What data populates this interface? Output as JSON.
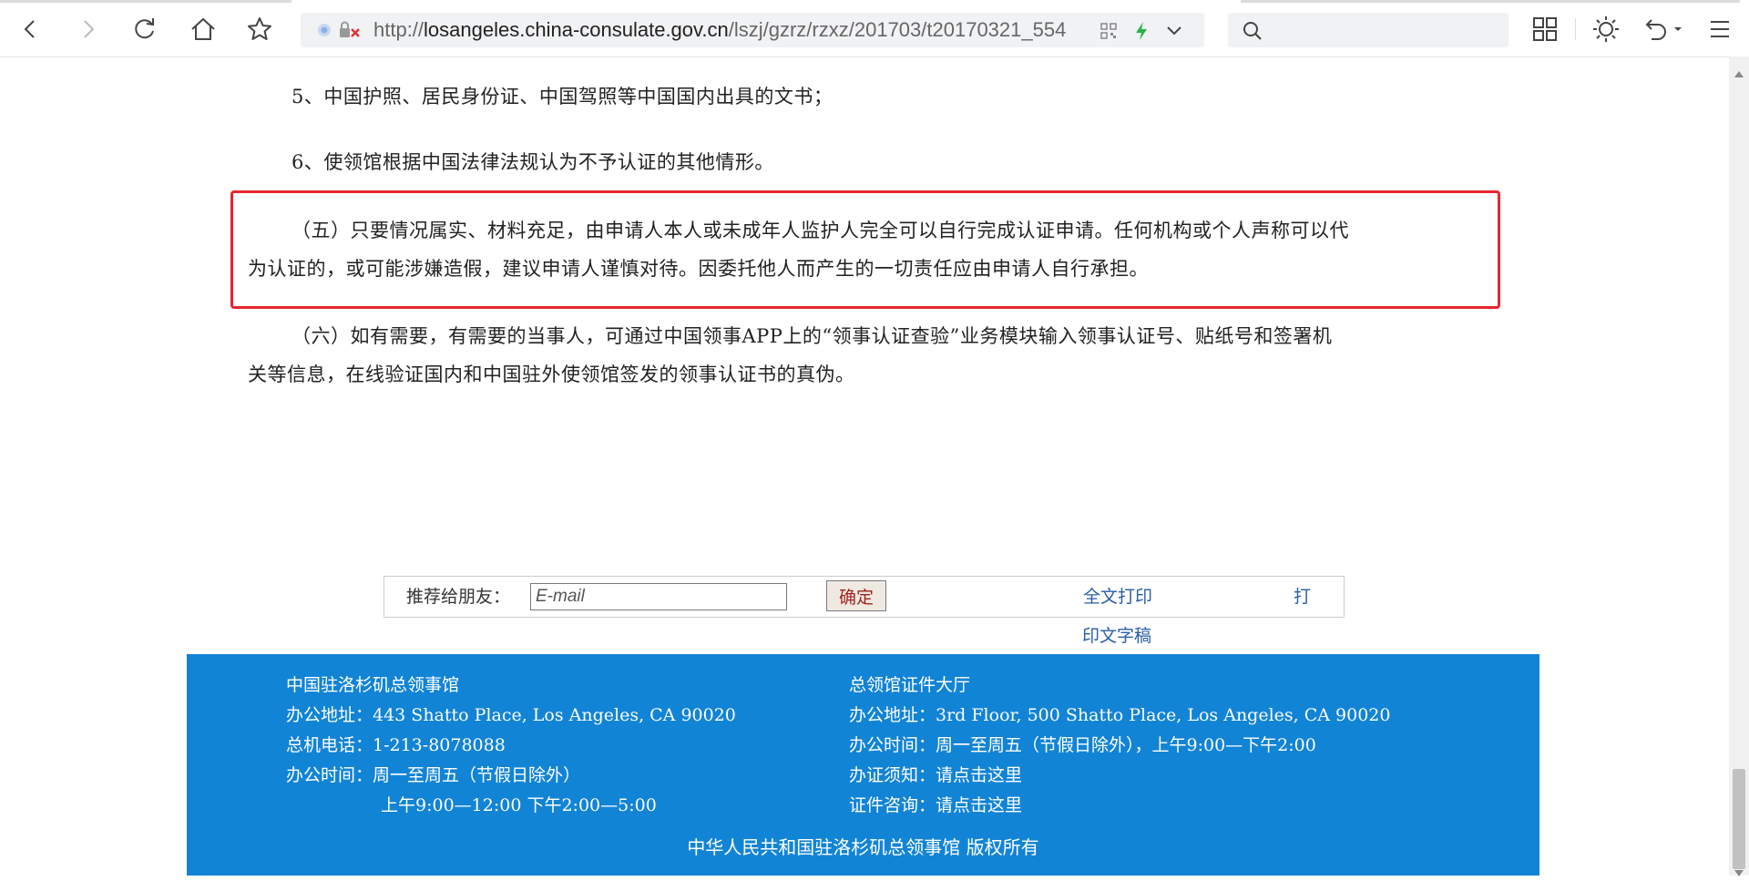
{
  "browser": {
    "url_scheme": "http://",
    "url_host": "losangeles.china-consulate.gov.cn",
    "url_path": "/lszj/gzrz/rzxz/201703/t20170321_554",
    "icons": [
      "back-icon",
      "forward-icon",
      "reload-icon",
      "home-icon",
      "bookmark-star-icon",
      "qr-code-icon",
      "lightning-icon",
      "chevron-down-icon",
      "search-icon",
      "grid-icon",
      "brightness-icon",
      "undo-icon",
      "menu-icon"
    ]
  },
  "article": {
    "item5": "5、中国护照、居民身份证、中国驾照等中国国内出具的文书；",
    "item6": "6、使领馆根据中国法律法规认为不予认证的其他情形。",
    "section5_line1": "（五）只要情况属实、材料充足，由申请人本人或未成年人监护人完全可以自行完成认证申请。任何机构或个人声称可以代",
    "section5_line2": "为认证的，或可能涉嫌造假，建议申请人谨慎对待。因委托他人而产生的一切责任应由申请人自行承担。",
    "section6_line1": "（六）如有需要，有需要的当事人，可通过中国领事APP上的“领事认证查验”业务模块输入领事认证号、贴纸号和签署机",
    "section6_line2": "关等信息，在线验证国内和中国驻外使领馆签发的领事认证书的真伪。",
    "highlight_color": "#e8262f"
  },
  "share": {
    "label": "推荐给朋友：",
    "email_placeholder": "E-mail",
    "confirm_label": "确定",
    "print_full_label": "全文打印",
    "print_draft_part1": "打",
    "print_draft_part2": "印文字稿"
  },
  "footer": {
    "background": "#1284d6",
    "left": {
      "title": "中国驻洛杉矶总领事馆",
      "address": "办公地址：443 Shatto Place, Los Angeles, CA 90020",
      "phone": "总机电话：1-213-8078088",
      "hours": "办公时间：周一至周五（节假日除外）",
      "hours_detail": "上午9:00—12:00 下午2:00—5:00"
    },
    "right": {
      "title": "总领馆证件大厅",
      "address": "办公地址：3rd Floor, 500 Shatto Place, Los Angeles, CA 90020",
      "hours": "办公时间：周一至周五（节假日除外），上午9:00—下午2:00",
      "notice_prefix": "办证须知：",
      "notice_link": "请点击这里",
      "inquiry_prefix": "证件咨询：",
      "inquiry_link": "请点击这里"
    },
    "copyright": "中华人民共和国驻洛杉矶总领事馆 版权所有"
  }
}
